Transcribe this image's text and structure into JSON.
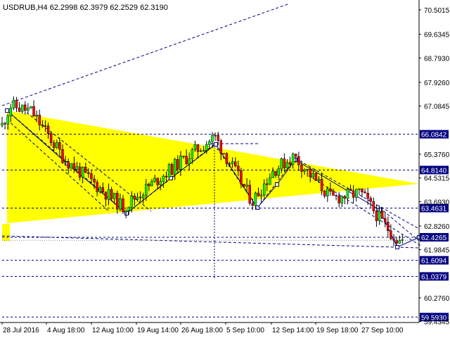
{
  "window": {
    "title": "USDRUB,H4  62.2998 62.3979 62.2529 62.3190"
  },
  "chart_data": {
    "type": "candlestick",
    "symbol": "USDRUB",
    "timeframe": "H4",
    "ohlc_header": {
      "open": 62.2998,
      "high": 62.3979,
      "low": 62.2529,
      "close": 62.319
    },
    "ylim": [
      59.4,
      70.8
    ],
    "price_ticks": [
      "70.5015",
      "69.6345",
      "68.7930",
      "67.9260",
      "67.0845",
      "65.3760",
      "64.5315",
      "63.6930",
      "62.8260",
      "61.9845",
      "60.2760",
      "59.4345"
    ],
    "time_ticks": [
      "28 Jul 2016",
      "4 Aug 18:00",
      "12 Aug 10:00",
      "19 Aug 14:00",
      "26 Aug 18:00",
      "5 Sep 10:00",
      "12 Sep 14:00",
      "19 Sep 18:00",
      "27 Sep 10:00"
    ],
    "level_lines": [
      {
        "value": 66.0842,
        "label": "66.0842"
      },
      {
        "value": 64.814,
        "label": "64.8140"
      },
      {
        "value": 63.4631,
        "label": "63.4631"
      },
      {
        "value": 62.4265,
        "label": "62.4265"
      },
      {
        "value": 61.6094,
        "label": "61.6094"
      },
      {
        "value": 61.0379,
        "label": "61.0379"
      },
      {
        "value": 59.593,
        "label": "59.5930"
      }
    ],
    "current_price": 62.319,
    "colors": {
      "bull": "#00ff00",
      "bear": "#ff0000",
      "triangle": "#ffff00",
      "line": "#000080",
      "level": "#000080"
    }
  }
}
